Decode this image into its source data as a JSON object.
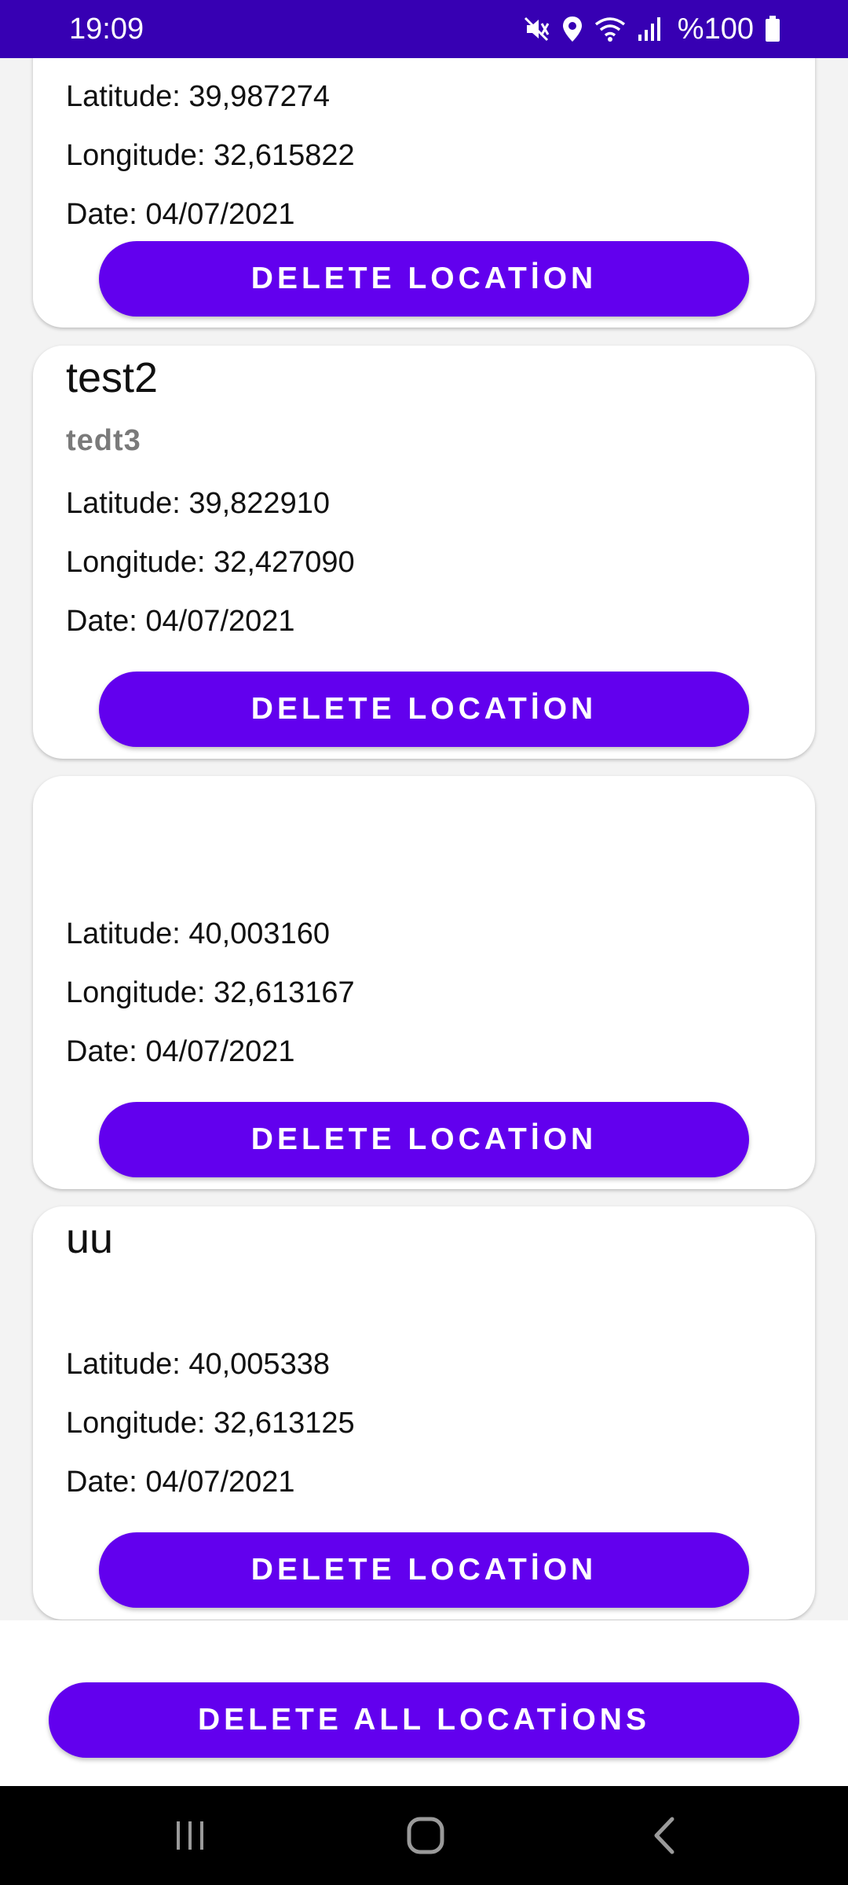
{
  "status_bar": {
    "time": "19:09",
    "battery": "%100",
    "icons": [
      "mute-icon",
      "location-icon",
      "wifi-icon",
      "signal-icon",
      "battery-icon"
    ]
  },
  "cards": [
    {
      "name": "",
      "description": "",
      "latitude": "Latitude: 39,987274",
      "longitude": "Longitude: 32,615822",
      "date": "Date: 04/07/2021",
      "button": "DELETE LOCATİON"
    },
    {
      "name": "test2",
      "description": "tedt3",
      "latitude": "Latitude: 39,822910",
      "longitude": "Longitude: 32,427090",
      "date": "Date: 04/07/2021",
      "button": "DELETE LOCATİON"
    },
    {
      "name": "",
      "description": "",
      "latitude": "Latitude: 40,003160",
      "longitude": "Longitude: 32,613167",
      "date": "Date: 04/07/2021",
      "button": "DELETE LOCATİON"
    },
    {
      "name": "uu",
      "description": "",
      "latitude": "Latitude: 40,005338",
      "longitude": "Longitude: 32,613125",
      "date": "Date: 04/07/2021",
      "button": "DELETE LOCATİON"
    }
  ],
  "delete_all_label": "DELETE ALL LOCATİONS",
  "nav_bar": {
    "icons": [
      "recents-icon",
      "home-icon",
      "back-icon"
    ]
  },
  "colors": {
    "status_bar": "#3700b3",
    "accent": "#6200ee"
  }
}
